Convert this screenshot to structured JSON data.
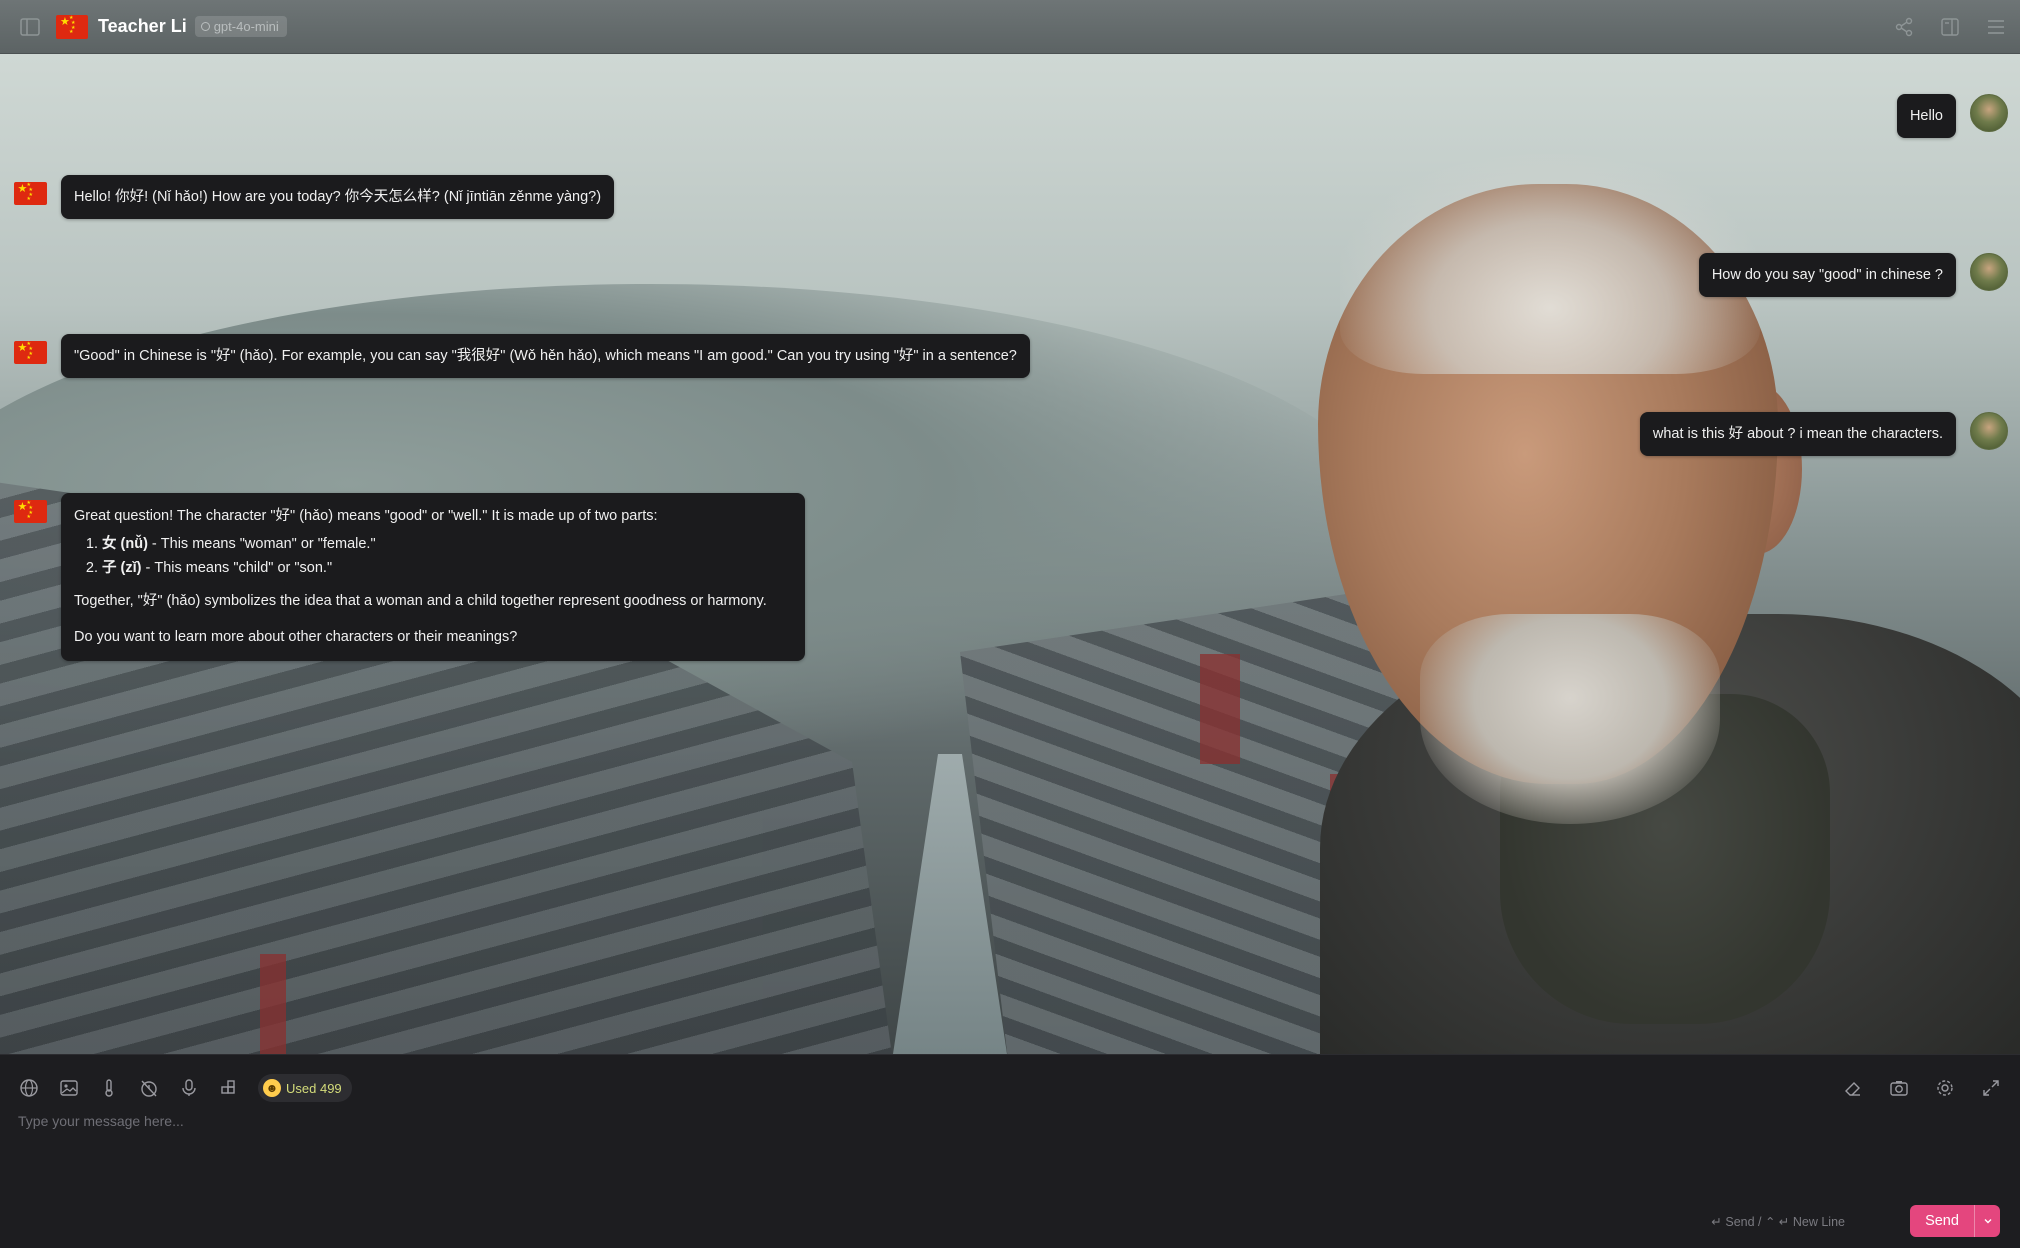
{
  "header": {
    "title": "Teacher Li",
    "model": "gpt-4o-mini",
    "icons": [
      "sidebar-toggle-icon",
      "share-icon",
      "layout-icon",
      "menu-icon"
    ]
  },
  "messages": [
    {
      "role": "user",
      "text": "Hello"
    },
    {
      "role": "assistant",
      "text": "Hello! 你好! (Nǐ hǎo!) How are you today? 你今天怎么样? (Nǐ jīntiān zěnme yàng?)"
    },
    {
      "role": "user",
      "text": "How do you say \"good\" in chinese ?"
    },
    {
      "role": "assistant",
      "text": "\"Good\" in Chinese is \"好\" (hǎo). For example, you can say \"我很好\" (Wǒ hěn hǎo), which means \"I am good.\" Can you try using \"好\" in a sentence?"
    },
    {
      "role": "user",
      "text": "what is this 好 about ? i mean the characters."
    },
    {
      "role": "assistant",
      "intro": "Great question! The character \"好\" (hǎo) means \"good\" or \"well.\" It is made up of two parts:",
      "list": [
        {
          "term": "女 (nǚ)",
          "desc": " - This means \"woman\" or \"female.\""
        },
        {
          "term": "子 (zǐ)",
          "desc": " - This means \"child\" or \"son.\""
        }
      ],
      "para1": "Together, \"好\" (hǎo) symbolizes the idea that a woman and a child together represent goodness or harmony.",
      "para2": "Do you want to learn more about other characters or their meanings?"
    }
  ],
  "composer": {
    "used_label": "Used 499",
    "placeholder": "Type your message here...",
    "hint": "↵ Send / ⌃ ↵ New Line",
    "send_label": "Send",
    "tool_icons": [
      "globe-icon",
      "image-icon",
      "thermometer-icon",
      "timer-off-icon",
      "microphone-icon",
      "plugins-icon"
    ],
    "right_icons": [
      "eraser-icon",
      "camera-icon",
      "settings-icon",
      "expand-icon"
    ]
  },
  "colors": {
    "accent": "#e4467e",
    "bubble": "#1b1b1d",
    "flag_red": "#de2910",
    "flag_star": "#ffde00"
  }
}
